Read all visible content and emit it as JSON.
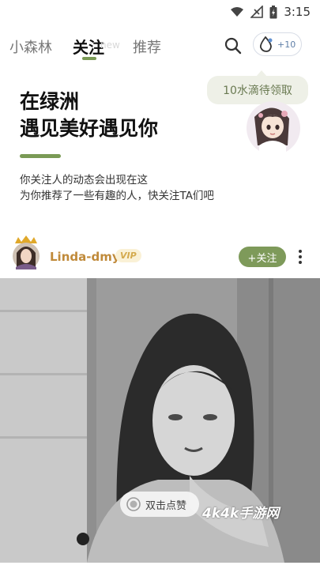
{
  "status_bar": {
    "time": "3:15"
  },
  "top_nav": {
    "tabs": [
      {
        "label": "小森林"
      },
      {
        "label": "关注"
      },
      {
        "label": "推荐"
      }
    ],
    "ghost_tab": "new",
    "drop_count": "+10"
  },
  "tooltip": {
    "text": "10水滴待领取"
  },
  "header": {
    "headline": [
      "在绿洲",
      "遇见美好遇见你"
    ],
    "description": [
      "你关注人的动态会出现在这",
      "为你推荐了一些有趣的人，快关注TA们吧"
    ]
  },
  "post": {
    "username": "Linda-dmy",
    "vip_label": "VIP",
    "follow_label": "+关注",
    "like_hint": "双击点赞",
    "watermark": "4k4k手游网"
  },
  "colors": {
    "accent_green": "#7a9a55",
    "username_gold": "#c08a3a",
    "follow_green": "#7e9a5a"
  },
  "icons": [
    "wifi-icon",
    "signal-icon",
    "battery-icon",
    "search-icon",
    "water-drop-icon",
    "more-icon",
    "heart-icon"
  ]
}
